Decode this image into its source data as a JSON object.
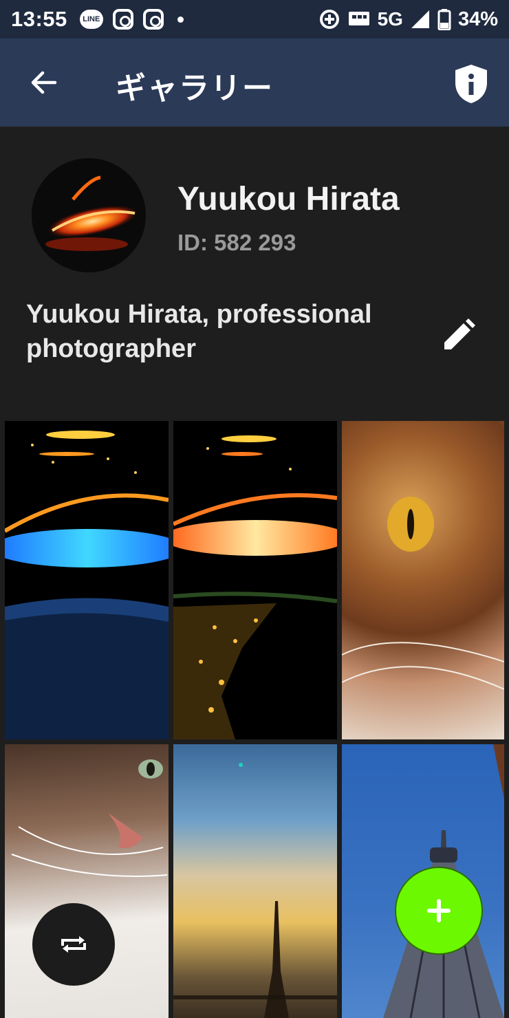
{
  "status_bar": {
    "time": "13:55",
    "line_badge": "LINE",
    "network": "5G",
    "battery": "34%"
  },
  "app_bar": {
    "title": "ギャラリー"
  },
  "profile": {
    "name": "Yuukou Hirata",
    "id_text": "ID: 582 293",
    "bio": "Yuukou Hirata, professional photographer"
  },
  "gallery": {
    "tiles": [
      {
        "subject": "light streaks over earth (blue)"
      },
      {
        "subject": "light streaks over city lights at night"
      },
      {
        "subject": "close-up of tabby cat eye"
      },
      {
        "subject": "fluffy cat portrait"
      },
      {
        "subject": "tower silhouette against sunset clouds"
      },
      {
        "subject": "tower against blue sky"
      }
    ]
  },
  "icons": {
    "back": "arrow-left-icon",
    "info": "shield-info-icon",
    "edit": "pencil-icon",
    "swap": "swap-icon",
    "add": "plus-icon"
  },
  "colors": {
    "status_bar": "#1f2a3f",
    "app_bar": "#2b3a57",
    "background": "#1e1e1e",
    "fab_add": "#6cf800",
    "fab_swap": "#1c1c1c"
  }
}
